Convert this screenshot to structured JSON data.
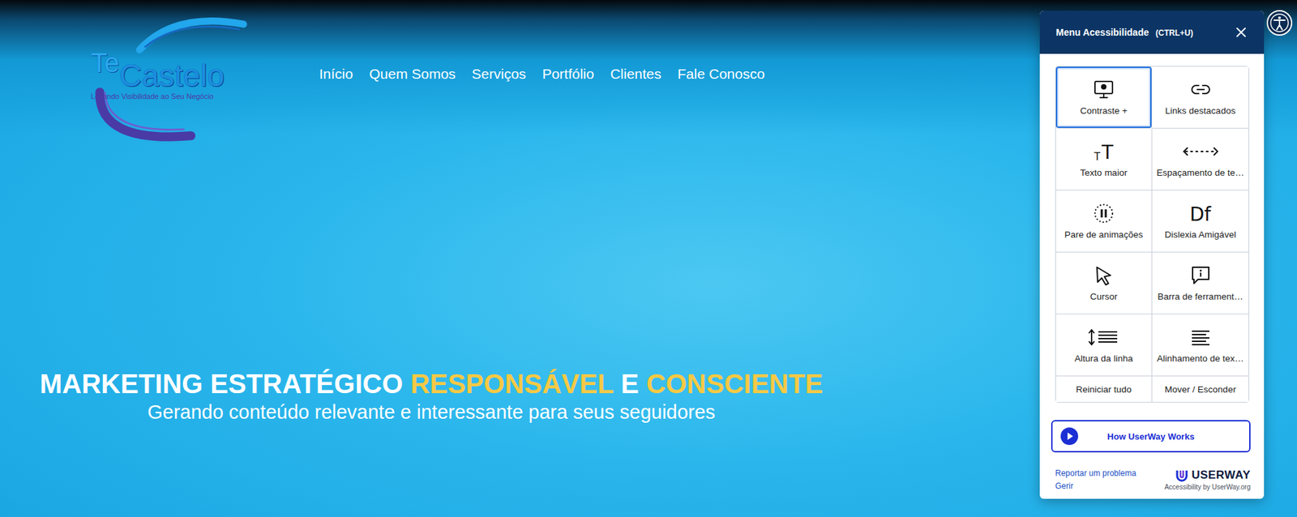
{
  "logo": {
    "prefix": "Te",
    "name": "Castelo",
    "tagline": "Levando Visibilidade ao Seu Negócio"
  },
  "nav": [
    "Início",
    "Quem Somos",
    "Serviços",
    "Portfólio",
    "Clientes",
    "Fale Conosco"
  ],
  "hero": {
    "headline": [
      {
        "text": "MARKETING ESTRATÉGICO ",
        "highlight": false
      },
      {
        "text": "RESPONSÁVEL",
        "highlight": true
      },
      {
        "text": " E ",
        "highlight": false
      },
      {
        "text": "CONSCIENTE",
        "highlight": true
      }
    ],
    "subtitle": "Gerando conteúdo relevante e interessante para seus seguidores"
  },
  "accessibility_menu": {
    "title": "Menu Acessibilidade",
    "shortcut": "(CTRL+U)",
    "tools": [
      {
        "label": "Contraste +",
        "selected": true
      },
      {
        "label": "Links destacados",
        "selected": false
      },
      {
        "label": "Texto maior",
        "selected": false,
        "glyph": [
          "T",
          "T"
        ]
      },
      {
        "label": "Espaçamento de te…",
        "selected": false
      },
      {
        "label": "Pare de animações",
        "selected": false
      },
      {
        "label": "Dislexia Amigável",
        "selected": false,
        "glyph": [
          "Df"
        ]
      },
      {
        "label": "Cursor",
        "selected": false
      },
      {
        "label": "Barra de ferrament…",
        "selected": false
      },
      {
        "label": "Altura da linha",
        "selected": false
      },
      {
        "label": "Alinhamento de tex…",
        "selected": false
      }
    ],
    "actions": [
      "Reiniciar tudo",
      "Mover / Esconder"
    ],
    "video_button": "How UserWay Works",
    "links": [
      "Reportar um problema",
      "Gerir"
    ],
    "brand": "USERWAY",
    "credit": "Accessibility by UserWay.org"
  }
}
